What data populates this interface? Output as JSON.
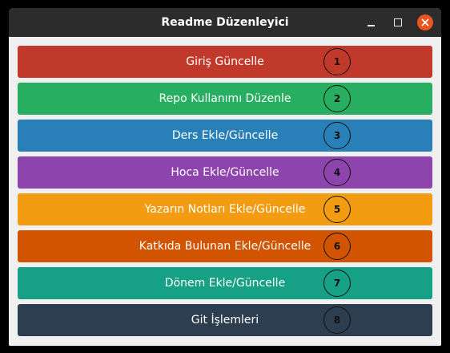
{
  "window": {
    "title": "Readme Düzenleyici"
  },
  "buttons": [
    {
      "label": "Giriş Güncelle",
      "number": "1",
      "color": "#c0392b"
    },
    {
      "label": "Repo Kullanımı Düzenle",
      "number": "2",
      "color": "#27ae60"
    },
    {
      "label": "Ders Ekle/Güncelle",
      "number": "3",
      "color": "#2980b9"
    },
    {
      "label": "Hoca Ekle/Güncelle",
      "number": "4",
      "color": "#8e44ad"
    },
    {
      "label": "Yazarın Notları Ekle/Güncelle",
      "number": "5",
      "color": "#f39c12"
    },
    {
      "label": "Katkıda Bulunan Ekle/Güncelle",
      "number": "6",
      "color": "#d35400"
    },
    {
      "label": "Dönem Ekle/Güncelle",
      "number": "7",
      "color": "#16a085"
    },
    {
      "label": "Git İşlemleri",
      "number": "8",
      "color": "#2c3e50"
    }
  ]
}
